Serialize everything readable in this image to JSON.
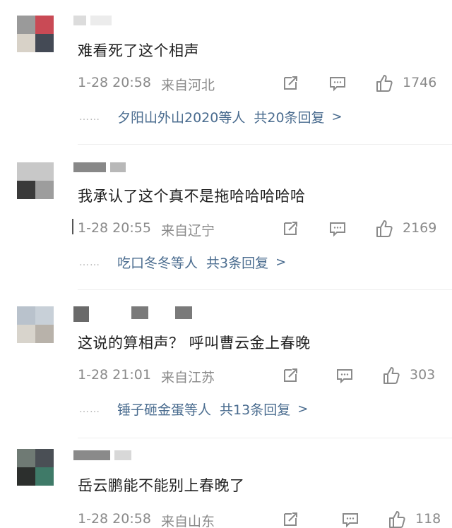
{
  "comments": [
    {
      "text": "难看死了这个相声",
      "time": "1-28 20:58",
      "location": "来自河北",
      "likes": "1746",
      "replies": {
        "who": "夕阳山外山2020等人",
        "total": "共20条回复",
        "dots": "……",
        "chevron": ">"
      },
      "avatar_colors": [
        "#9a9a9a",
        "#c94a55",
        "#d8d2c8",
        "#444a55"
      ],
      "name_colors": [
        "#dcdcdc",
        "#ececec"
      ]
    },
    {
      "text": "我承认了这个真不是拖哈哈哈哈哈",
      "time": "1-28 20:55",
      "location": "来自辽宁",
      "likes": "2169",
      "replies": {
        "who": "吃口冬冬等人",
        "total": "共3条回复",
        "dots": "……",
        "chevron": ">"
      },
      "avatar_colors": [
        "#c8c8c8",
        "#c8c8c8",
        "#3a3a3a",
        "#9d9d9d"
      ],
      "name_colors": [
        "#888888",
        "#b8b8b8"
      ]
    },
    {
      "text": "这说的算相声？ 呼叫曹云金上春晚",
      "time": "1-28 21:01",
      "location": "来自江苏",
      "likes": "303",
      "replies": {
        "who": "锤子砸金蛋等人",
        "total": "共13条回复",
        "dots": "……",
        "chevron": ">"
      },
      "avatar_colors": [
        "#b9c2cc",
        "#c8d0d8",
        "#d8d4cc",
        "#b8b2aa"
      ],
      "name_colors": [
        "#6a6a6a",
        "#7a7a7a"
      ]
    },
    {
      "text": "岳云鹏能不能别上春晚了",
      "time": "1-28 20:58",
      "location": "来自山东",
      "likes": "118",
      "avatar_colors": [
        "#6f7a74",
        "#4a4f55",
        "#2c2f2d",
        "#3f7a68"
      ],
      "name_colors": [
        "#8a8a8a",
        "#d8d8d8"
      ]
    }
  ],
  "colors": {
    "link": "#4a6c8f",
    "meta": "#8a8a8a",
    "icon": "#8a8a8a"
  },
  "icons": {
    "share": "share-icon",
    "comment": "comment-icon",
    "like": "thumbs-up-icon"
  }
}
